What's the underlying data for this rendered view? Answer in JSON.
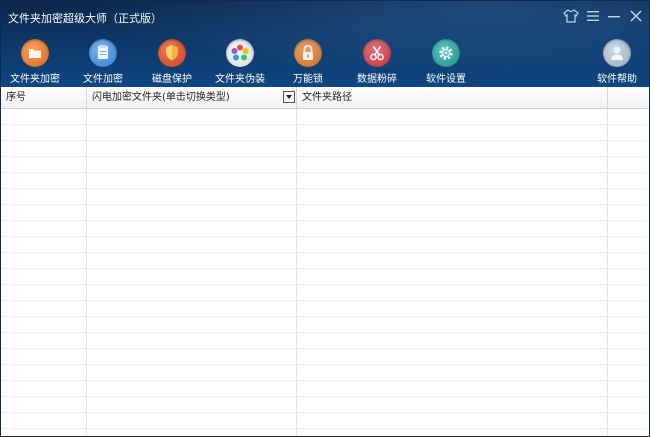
{
  "app": {
    "title": "文件夹加密超级大师（正式版）"
  },
  "window_controls": {
    "skin": "skin-icon",
    "menu": "menu-icon",
    "minimize": "minimize-icon",
    "close": "close-icon"
  },
  "toolbar": [
    {
      "label": "文件夹加密",
      "icon": "folder-encrypt-icon",
      "color": "#e07a2b"
    },
    {
      "label": "文件加密",
      "icon": "file-encrypt-icon",
      "color": "#3d8fd8"
    },
    {
      "label": "磁盘保护",
      "icon": "shield-icon",
      "color": "#d9522e"
    },
    {
      "label": "文件夹伪装",
      "icon": "disguise-icon",
      "color": "#6cc04a"
    },
    {
      "label": "万能锁",
      "icon": "lock-icon",
      "color": "#e07a2b"
    },
    {
      "label": "数据粉碎",
      "icon": "shred-icon",
      "color": "#d93d3d"
    },
    {
      "label": "软件设置",
      "icon": "gear-icon",
      "color": "#27a38f"
    },
    {
      "label": "软件帮助",
      "icon": "help-icon",
      "color": "#6c7f96"
    }
  ],
  "table": {
    "columns": [
      "序号",
      "闪电加密文件夹(单击切换类型)",
      "文件夹路径",
      ""
    ],
    "rows": []
  }
}
